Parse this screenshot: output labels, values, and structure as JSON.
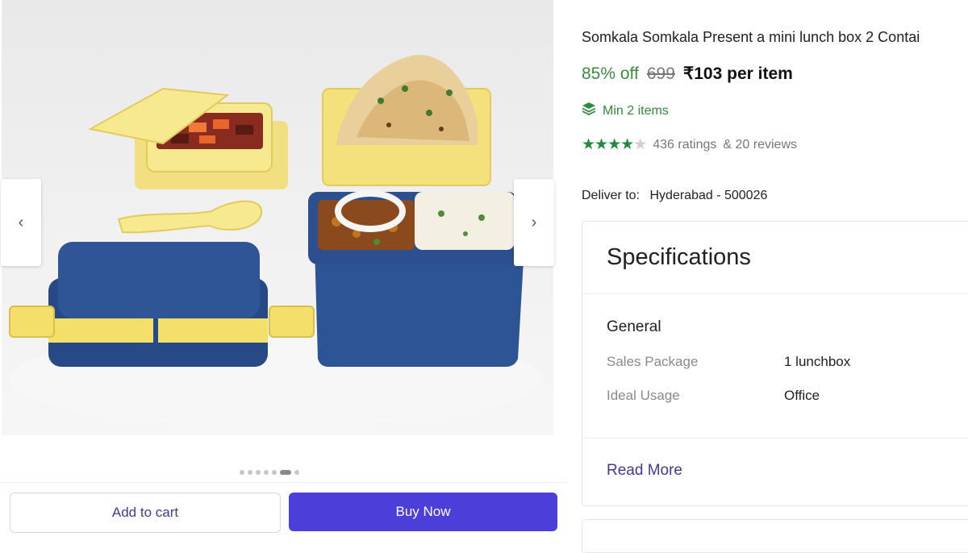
{
  "gallery": {
    "prev_arrow": "‹",
    "next_arrow": "›",
    "dot_count": 7,
    "active_dot": 5
  },
  "actions": {
    "add_to_cart": "Add to cart",
    "buy_now": "Buy Now"
  },
  "product": {
    "title": "Somkala Somkala Present a mini lunch box 2 Contai",
    "discount": "85% off",
    "mrp": "699",
    "price": "₹103 per item",
    "min_items": "Min 2 items",
    "rating_stars": 4,
    "ratings": "436 ratings",
    "reviews": "& 20 reviews"
  },
  "delivery": {
    "label": "Deliver to:",
    "location": "Hyderabad - 500026"
  },
  "specifications": {
    "heading": "Specifications",
    "group": "General",
    "rows": [
      {
        "key": "Sales Package",
        "value": "1 lunchbox"
      },
      {
        "key": "Ideal Usage",
        "value": "Office"
      }
    ],
    "read_more": "Read More"
  },
  "colors": {
    "accent": "#4b3ed9",
    "discount_green": "#388e3c",
    "star_green": "#1f8b3b"
  },
  "icons": {
    "min_items": "stack-layers-icon",
    "prev": "chevron-left-icon",
    "next": "chevron-right-icon"
  }
}
